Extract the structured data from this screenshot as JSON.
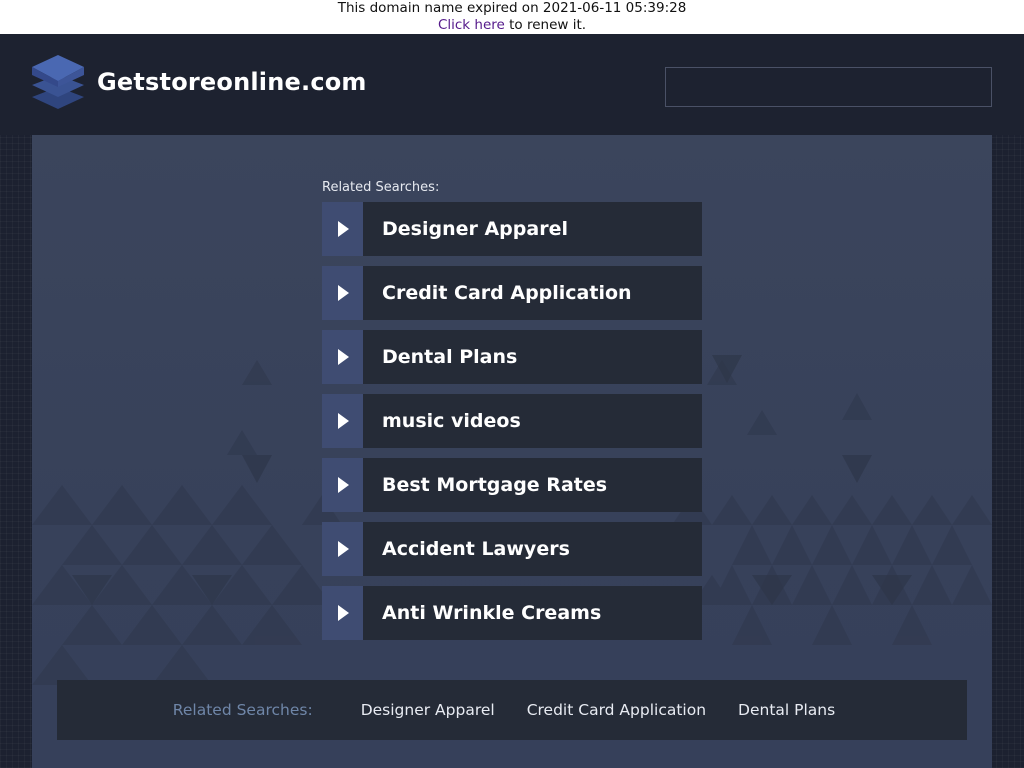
{
  "expiry_notice": {
    "text": "This domain name expired on 2021-06-11 05:39:28",
    "renew_link": "Click here",
    "renew_suffix": " to renew it."
  },
  "header": {
    "site_name": "Getstoreonline.com",
    "search_value": ""
  },
  "related": {
    "heading": "Related Searches:",
    "items": [
      "Designer Apparel",
      "Credit Card Application",
      "Dental Plans",
      "music videos",
      "Best Mortgage Rates",
      "Accident Lawyers",
      "Anti Wrinkle Creams"
    ]
  },
  "footer": {
    "label": "Related Searches:",
    "links": [
      "Designer Apparel",
      "Credit Card Application",
      "Dental Plans"
    ]
  },
  "colors": {
    "header_bg": "#1d2230",
    "main_bg": "#3b455c",
    "link_bg": "#252b37",
    "arrow_bg": "#3f4c72",
    "logo": "#3f5a9e",
    "footer_label": "#6f86a8"
  },
  "icons": {
    "logo": "stacked-layers-icon",
    "link_arrow": "play-arrow-icon"
  }
}
